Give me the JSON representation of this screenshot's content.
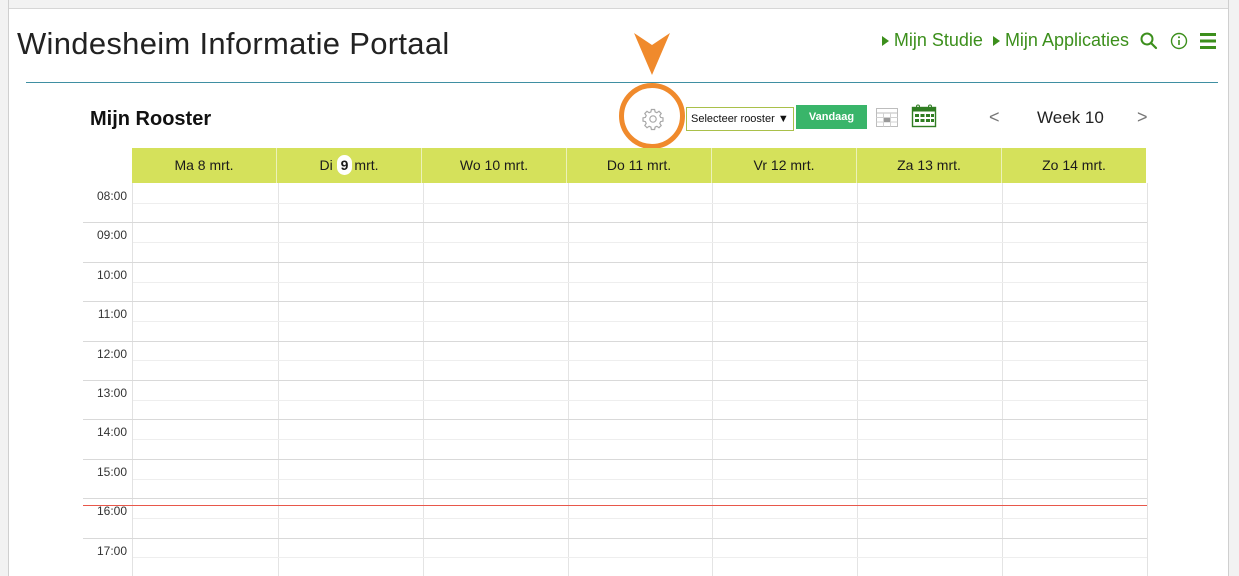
{
  "header": {
    "portal_title": "Windesheim Informatie Portaal",
    "nav": [
      {
        "label": "Mijn Studie"
      },
      {
        "label": "Mijn Applicaties"
      }
    ],
    "icons": [
      "search-icon",
      "info-icon",
      "menu-icon"
    ],
    "accent_color": "#3c8f1c"
  },
  "rooster": {
    "title": "Mijn Rooster",
    "select_label": "Selecteer rooster ▼",
    "today_button": "Vandaag",
    "prev": "<",
    "next": ">",
    "week_label": "Week 10",
    "today_color": "#39b56a",
    "highlight_color": "#f08a2c"
  },
  "days": [
    {
      "pre": "Ma 8 mrt.",
      "num": "",
      "post": ""
    },
    {
      "pre": "Di",
      "num": "9",
      "post": "mrt."
    },
    {
      "pre": "Wo 10 mrt.",
      "num": "",
      "post": ""
    },
    {
      "pre": "Do 11 mrt.",
      "num": "",
      "post": ""
    },
    {
      "pre": "Vr 12 mrt.",
      "num": "",
      "post": ""
    },
    {
      "pre": "Za 13 mrt.",
      "num": "",
      "post": ""
    },
    {
      "pre": "Zo 14 mrt.",
      "num": "",
      "post": ""
    }
  ],
  "hours": [
    "08:00",
    "09:00",
    "10:00",
    "11:00",
    "12:00",
    "13:00",
    "14:00",
    "15:00",
    "16:00",
    "17:00"
  ],
  "current_time": "16:10",
  "header_color": "#d5e15b"
}
